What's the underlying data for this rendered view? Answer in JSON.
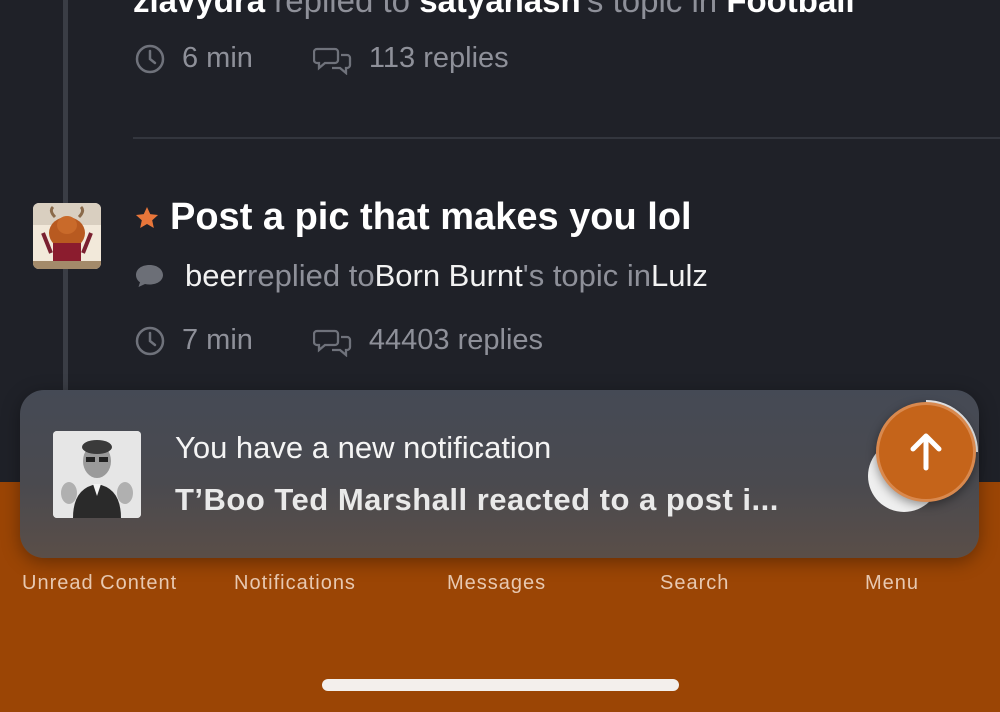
{
  "feed": {
    "item1": {
      "author": "zlavydra",
      "action": " replied to ",
      "target": "satyanash",
      "possessive": "'s topic in ",
      "forum": "Football",
      "time": "6 min",
      "replies": "113 replies"
    },
    "item2": {
      "title": "Post a pic that makes you lol",
      "author": "beer",
      "action": " replied to ",
      "target": "Born Burnt",
      "possessive": "'s topic in ",
      "forum": "Lulz",
      "time": "7 min",
      "replies": "44403 replies"
    }
  },
  "notification": {
    "title": "You have a new notification",
    "body": "T’Boo Ted Marshall reacted to a post i..."
  },
  "nav": {
    "unread": "Unread Content",
    "notifications": "Notifications",
    "messages": "Messages",
    "search": "Search",
    "menu": "Menu"
  },
  "colors": {
    "background": "#1f2128",
    "accent": "#c5641a",
    "nav_bar": "#9b4505",
    "star": "#e8763a"
  }
}
